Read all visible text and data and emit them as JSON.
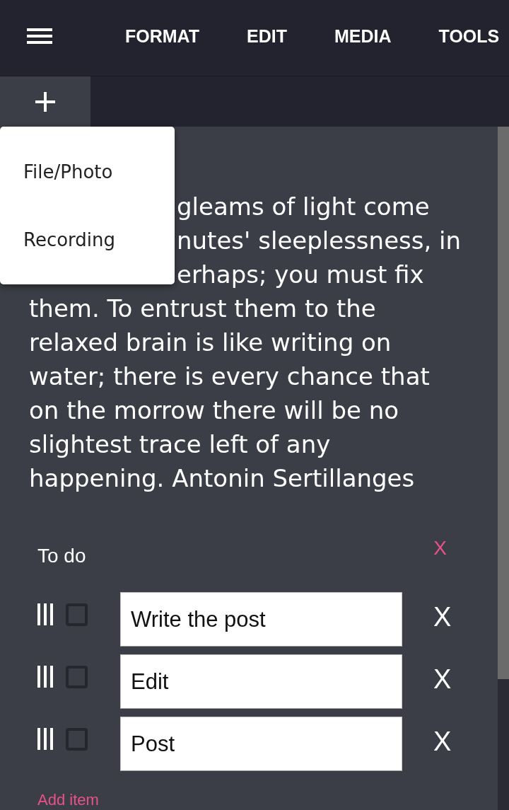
{
  "nav": [
    {
      "label": "FORMAT"
    },
    {
      "label": "EDIT"
    },
    {
      "label": "MEDIA"
    },
    {
      "label": "TOOLS"
    }
  ],
  "add_tab": {
    "expanded": true
  },
  "add_menu": {
    "items": [
      {
        "label": "File/Photo"
      },
      {
        "label": "Recording"
      }
    ]
  },
  "note": {
    "lines": [
      {
        "kind": "covered",
        "text": "gleams of light come"
      },
      {
        "kind": "covered",
        "text": "nutes' sleeplessness, in"
      },
      {
        "kind": "covered",
        "text": "erhaps; you must fix"
      },
      {
        "kind": "full",
        "text": "them. To entrust them to the"
      },
      {
        "kind": "full",
        "text": "relaxed brain is like writing on"
      },
      {
        "kind": "full",
        "text": "water; there is every chance that"
      },
      {
        "kind": "full",
        "text": "on the morrow there will be no"
      },
      {
        "kind": "full",
        "text": "slightest trace left of any"
      },
      {
        "kind": "full",
        "text": "happening. Antonin Sertillanges"
      }
    ]
  },
  "todo": {
    "title": "To do",
    "remove_label": "X",
    "items": [
      {
        "checked": false,
        "text": "Write the post",
        "delete_label": "X"
      },
      {
        "checked": false,
        "text": "Edit",
        "delete_label": "X"
      },
      {
        "checked": false,
        "text": "Post",
        "delete_label": "X"
      }
    ],
    "add_label": "Add item"
  }
}
